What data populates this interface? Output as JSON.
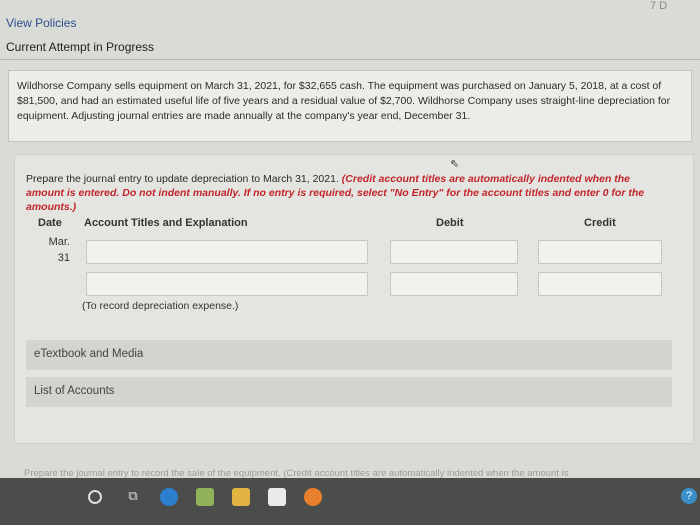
{
  "header": {
    "view_policies": "View Policies",
    "current_attempt": "Current Attempt in Progress",
    "corner_number": "7 D"
  },
  "problem": {
    "text": "Wildhorse Company sells equipment on March 31, 2021, for $32,655 cash. The equipment was purchased on January 5, 2018, at a cost of $81,500, and had an estimated useful life of five years and a residual value of $2,700. Wildhorse Company uses straight-line depreciation for equipment. Adjusting journal entries are made annually at the company's year end, December 31."
  },
  "question": {
    "prompt": "Prepare the journal entry to update depreciation to March 31, 2021.",
    "instructions": "(Credit account titles are automatically indented when the amount is entered. Do not indent manually. If no entry is required, select \"No Entry\" for the account titles and enter 0 for the amounts.)"
  },
  "table": {
    "headers": {
      "date": "Date",
      "account": "Account Titles and Explanation",
      "debit": "Debit",
      "credit": "Credit"
    },
    "date_month": "Mar.",
    "date_day": "31",
    "rows": [
      {
        "account": "",
        "debit": "",
        "credit": ""
      },
      {
        "account": "",
        "debit": "",
        "credit": ""
      }
    ],
    "note": "(To record depreciation expense.)"
  },
  "links": {
    "etextbook": "eTextbook and Media",
    "list_of_accounts": "List of Accounts"
  },
  "faded_text": "Prepare the journal entry to record the sale of the equipment. (Credit account titles are automatically indented when the amount is",
  "taskbar": {
    "help": "?"
  },
  "colors": {
    "accent_red": "#c2242b",
    "link_blue": "#2f4f8f",
    "taskbar": "#4b4d4b"
  }
}
